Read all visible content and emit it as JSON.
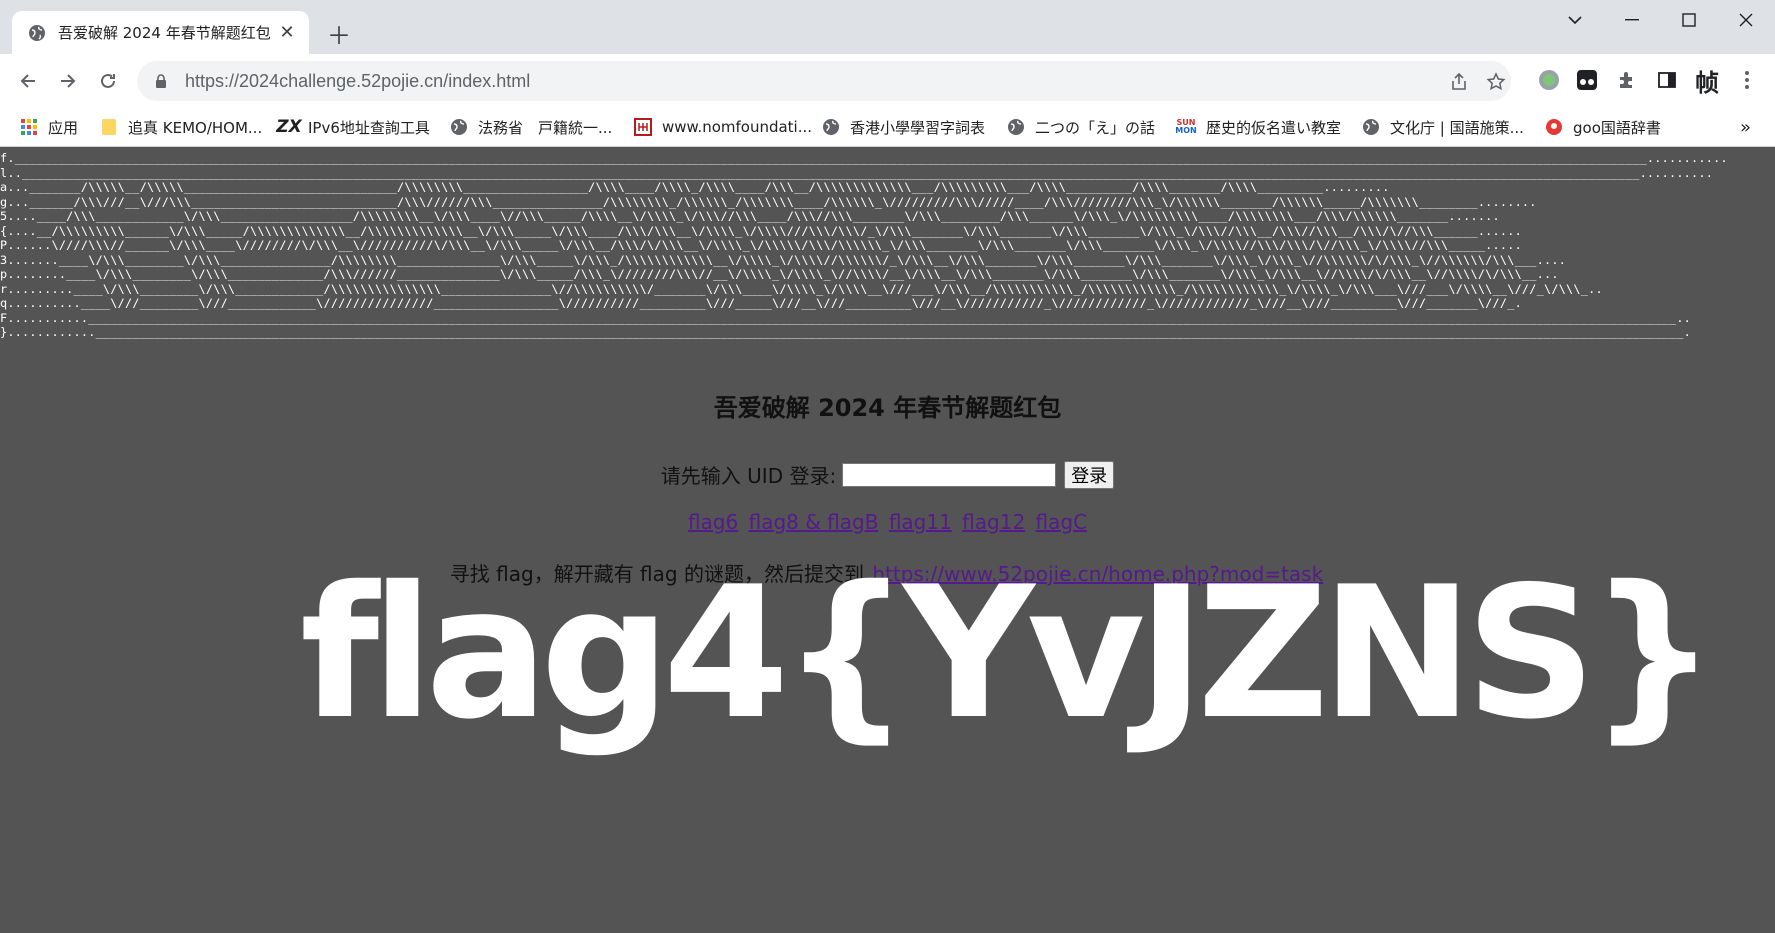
{
  "browser": {
    "tab": {
      "title": "吾爱破解 2024 年春节解题红包"
    },
    "address": {
      "scheme_host": "https://2024challenge.52pojie.cn",
      "path": "/index.html"
    },
    "bookmarks": [
      {
        "label": "应用",
        "icon": "apps-grid-icon"
      },
      {
        "label": "追真 KEMO/HOM...",
        "icon": "folder-icon"
      },
      {
        "label": "IPv6地址查詢工具",
        "icon": "zx-logo-icon"
      },
      {
        "label": "法務省　戸籍統一...",
        "icon": "globe-icon"
      },
      {
        "label": "www.nomfoundati...",
        "icon": "nom-logo-icon"
      },
      {
        "label": "香港小學學習字詞表",
        "icon": "globe-icon"
      },
      {
        "label": "二つの「え」の話",
        "icon": "globe-icon"
      },
      {
        "label": "歴史的仮名遣い教室",
        "icon": "sunmon-logo-icon"
      },
      {
        "label": "文化庁 | 国語施策...",
        "icon": "globe-icon"
      },
      {
        "label": "goo国語辞書",
        "icon": "goo-logo-icon"
      }
    ],
    "overflow": "»"
  },
  "page": {
    "ascii_lines": [
      "f.______________________________________________________________________________________________________________________________________________________________________________________________________________________________...........",
      "l..____________________________________________________________________________________________________________________________________________________________________________________________________________________________..........",
      "a..._______/\\\\\\\\\\__/\\\\\\\\\\_____________________________/\\\\\\\\\\\\\\\\_________________/\\\\\\\\____/\\\\\\\\_/\\\\\\\\____/\\\\\\__/\\\\\\\\\\\\\\\\\\\\\\\\\\___/\\\\\\\\\\\\\\\\\\___/\\\\\\\\_________/\\\\\\\\_______/\\\\\\\\_________.........",
      "g...______/\\\\\\///__\\///\\\\\\____________________________/\\\\\\//////\\\\\\_______________/\\\\\\\\\\\\\\\\_/\\\\\\\\\\\\_/\\\\\\\\\\\\\\____/\\\\\\\\\\\\_\\/////////\\\\\\/////____/\\\\\\////////\\\\\\_\\/\\\\\\\\\\\\_______/\\\\\\\\\\\\_____/\\\\\\\\\\\\\\________........",
      "5....____/\\\\\\____________\\/\\\\\\__________________/\\\\\\\\\\\\\\\\__\\/\\\\\\____\\//\\\\\\_____/\\\\\\\\__\\/\\\\\\\\_\\/\\\\\\//\\\\\\____/\\\\\\//\\\\\\_______\\/\\\\\\________/\\\\\\______\\/\\\\\\_\\/\\\\\\\\\\\\\\\\\\____/\\\\\\\\\\\\\\\\___/\\\\\\/\\\\\\\\\\\\_______.......",
      "{....__/\\\\\\\\\\\\\\\\\\______\\/\\\\\\_____/\\\\\\\\\\\\\\\\\\\\\\\\\\__/\\\\\\\\\\\\\\\\\\\\\\\\\\__\\/\\\\\\_____\\/\\\\\\____/\\\\\\/\\\\\\__\\/\\\\\\\\_\\/\\\\\\\\///\\\\\\/\\\\\\/_\\/\\\\\\_______\\/\\\\\\_______\\/\\\\\\_______\\/\\\\\\_\\/\\\\\\//\\\\\\__/\\\\\\//\\\\\\__/\\\\\\/\\//\\\\\\______......",
      "P......\\////\\\\\\//______\\/\\\\\\____\\////////\\/\\\\\\__\\//////////\\/\\\\\\__\\/\\\\\\_____\\/\\\\\\__/\\\\\\/\\/\\\\\\__\\/\\\\\\\\_\\/\\\\\\\\\\/\\\\\\/\\\\\\\\\\\\_\\/\\\\\\_______\\/\\\\\\_______\\/\\\\\\_______\\/\\\\\\_\\/\\\\\\\\//\\\\\\/\\\\\\/\\//\\\\\\_\\/\\\\\\\\//\\\\\\_____.....",
      "3.......____\\/\\\\\\________\\/\\\\\\_______________/\\\\\\\\\\\\\\\\______________\\/\\\\\\_____\\/\\\\\\_/\\\\\\\\\\\\\\\\\\\\\\\\__\\/\\\\\\\\_\\/\\\\\\\\//\\\\\\\\\\\\/_\\/\\\\\\__\\/\\\\\\_______\\/\\\\\\_______\\/\\\\\\_______\\/\\\\\\_\\/\\\\\\_\\//\\\\\\\\\\\\/\\/\\\\\\_\\//\\\\\\\\\\\\/\\\\\\___....",
      "p........____\\/\\\\\\________\\/\\\\\\_____________/\\\\\\//////______________\\/\\\\\\_____/\\\\\\_\\////////\\\\\\//__\\/\\\\\\\\_\\/\\\\\\\\_\\//\\\\\\\\/__\\/\\\\\\__\\/\\\\\\_______\\/\\\\\\_______\\/\\\\\\_______\\/\\\\\\_\\/\\\\\\__\\//\\\\\\\\/\\/\\\\\\__\\//\\\\\\\\/\\/\\\\\\__...",
      "r.........____\\/\\\\\\________\\/\\\\\\____________/\\\\\\\\\\\\\\\\\\\\\\\\\\\\\\_______________\\//\\\\\\\\\\\\\\\\\\\\/_______\\/\\\\\\____\\/\\\\\\\\_\\/\\\\\\\\__\\///___\\/\\\\\\__/\\\\\\\\\\\\\\\\\\\\\\_/\\\\\\\\\\\\\\\\\\\\\\\\_/\\\\\\\\\\\\\\\\\\\\\\\\_\\/\\\\\\\\_\\/\\\\\\___\\///___\\/\\\\\\\\__\\///_\\/\\\\\\_..",
      "q..........____\\///________\\///____________\\///////////////_________________\\//////////_________\\///_____\\///__\\///_________\\///__\\///////////_\\////////////_\\////////////_\\///__\\///_________\\///_______\\///_.",
      "F...........________________________________________________________________________________________________________________________________________________________________________________________________________________________..",
      "}............________________________________________________________________________________________________________________________________________________________________________________________________________________________."
    ],
    "heading": "吾爱破解 2024 年春节解题红包",
    "login": {
      "label": "请先输入 UID 登录:",
      "input_value": "",
      "button": "登录"
    },
    "flag_links": [
      "flag6",
      "flag8 & flagB",
      "flag11",
      "flag12",
      "flagC"
    ],
    "task": {
      "text": "寻找 flag，解开藏有 flag 的谜题，然后提交到",
      "link": "https://www.52pojie.cn/home.php?mod=task"
    },
    "overlay_flag": "flag4{YvJZNS}"
  },
  "colors": {
    "page_bg": "#545454",
    "tabstrip_bg": "#dee1e6",
    "visited_link": "#551a8b"
  }
}
